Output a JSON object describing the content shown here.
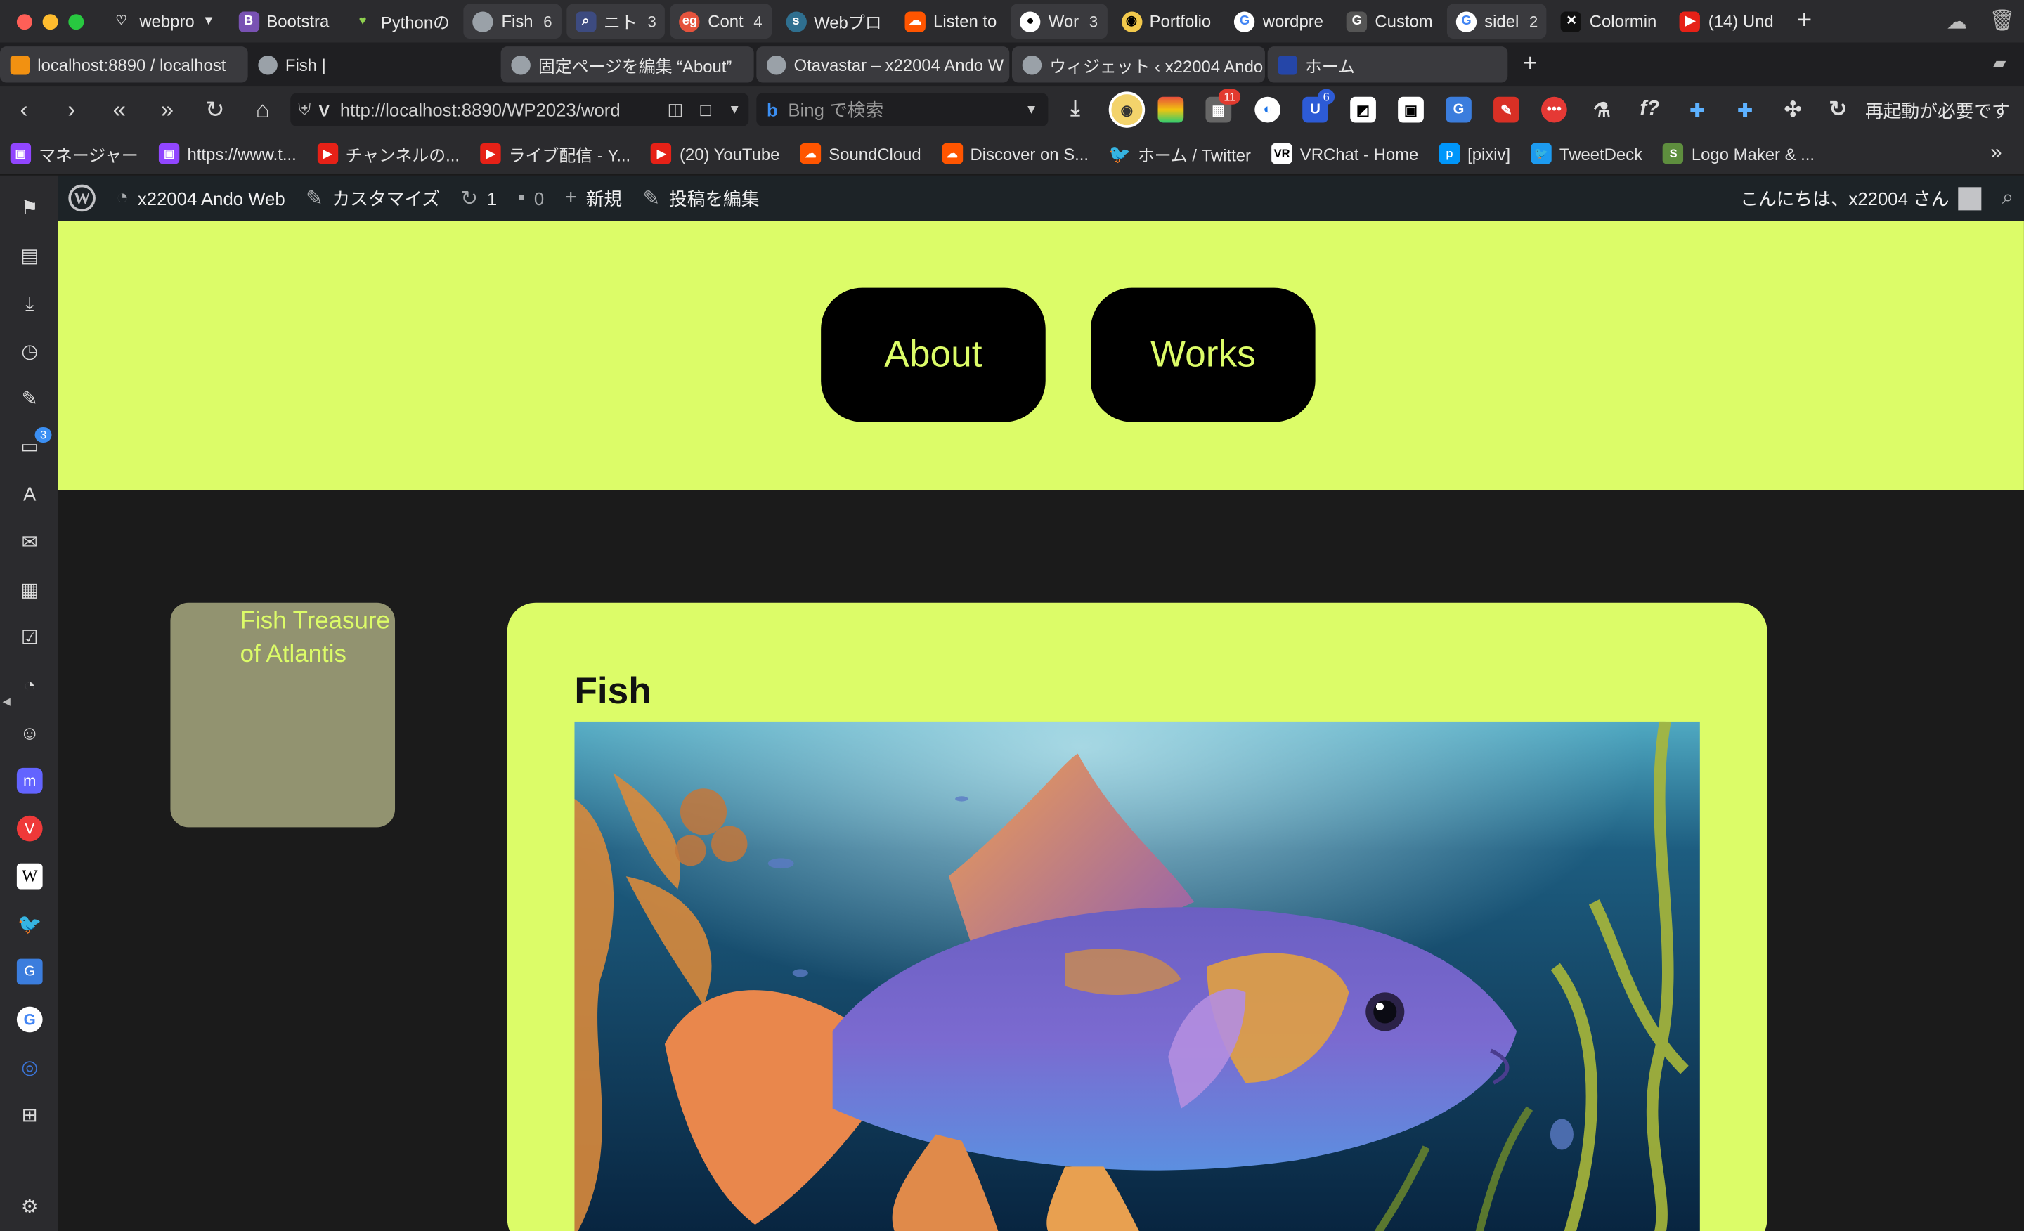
{
  "browser": {
    "tabs_top": [
      {
        "label": "webpro",
        "count": ""
      },
      {
        "label": "Bootstra",
        "count": ""
      },
      {
        "label": "Pythonの",
        "count": ""
      },
      {
        "label": "Fish",
        "count": "6"
      },
      {
        "label": "ニト",
        "count": "3"
      },
      {
        "label": "Cont",
        "count": "4"
      },
      {
        "label": "Webプロ",
        "count": ""
      },
      {
        "label": "Listen to",
        "count": ""
      },
      {
        "label": "Wor",
        "count": "3"
      },
      {
        "label": "Portfolio",
        "count": ""
      },
      {
        "label": "wordpre",
        "count": ""
      },
      {
        "label": "Custom",
        "count": ""
      },
      {
        "label": "sidel",
        "count": "2"
      },
      {
        "label": "Colormin",
        "count": ""
      },
      {
        "label": "(14) Und",
        "count": ""
      }
    ],
    "tabs_group": [
      {
        "label": "localhost:8890 / localhost"
      },
      {
        "label": "Fish |"
      },
      {
        "label": "固定ページを編集 “About”"
      },
      {
        "label": "Otavastar – x22004 Ando W"
      },
      {
        "label": "ウィジェット ‹ x22004 Ando"
      },
      {
        "label": "ホーム"
      }
    ],
    "url": "http://localhost:8890/WP2023/word",
    "url_host": "localhost",
    "search_placeholder": "Bing で検索",
    "restart_label": "再起動が必要です",
    "badges": {
      "ext_red": "11",
      "ext_blue": "6",
      "panel_badge": "3"
    },
    "bookmarks": [
      {
        "label": "マネージャー",
        "color": "#9146ff"
      },
      {
        "label": "https://www.t...",
        "color": "#9146ff"
      },
      {
        "label": "チャンネルの...",
        "color": "#e62117"
      },
      {
        "label": "ライブ配信 - Y...",
        "color": "#e62117"
      },
      {
        "label": "(20) YouTube",
        "color": "#e62117"
      },
      {
        "label": "SoundCloud",
        "color": "#ff5500"
      },
      {
        "label": "Discover on S...",
        "color": "#ff5500"
      },
      {
        "label": "ホーム / Twitter",
        "color": "#1d9bf0"
      },
      {
        "label": "VRChat - Home",
        "color": "#222222"
      },
      {
        "label": "[pixiv]",
        "color": "#0096fa"
      },
      {
        "label": "TweetDeck",
        "color": "#1d9bf0"
      },
      {
        "label": "Logo Maker & ...",
        "color": "#5e8e3e"
      }
    ]
  },
  "wp_admin": {
    "site_name": "x22004 Ando Web",
    "customize": "カスタマイズ",
    "updates": "1",
    "comments": "0",
    "new": "新規",
    "edit_post": "投稿を編集",
    "greeting": "こんにちは、x22004 さん"
  },
  "site": {
    "accent": "#dcfc68",
    "nav": [
      "About",
      "Works"
    ],
    "sidebar_text": "Fish Treasure of Atlantis",
    "post_title": "Fish"
  }
}
